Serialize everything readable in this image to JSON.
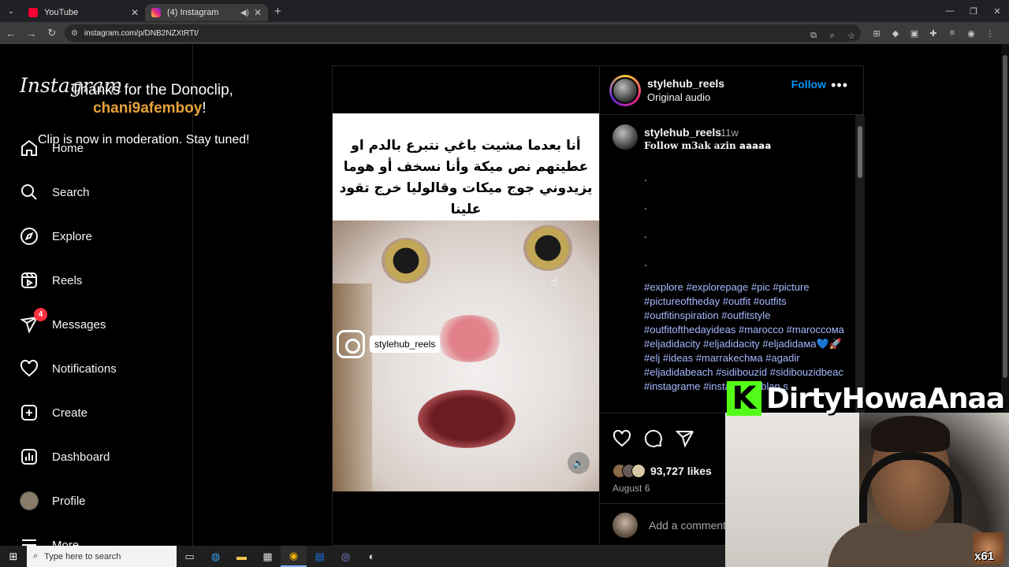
{
  "browser": {
    "tabs": [
      {
        "title": "YouTube",
        "active": false,
        "favicon": "youtube-favicon"
      },
      {
        "title": "(4) Instagram",
        "active": true,
        "favicon": "instagram-favicon"
      }
    ],
    "url": "instagram.com/p/DNB2NZXtRTt/"
  },
  "stream_alert": {
    "line1": "Thanks for the Donoclip,",
    "user": "chani9afemboy",
    "bang": "!",
    "line2": "Clip is now in moderation. Stay tuned!"
  },
  "sidebar": {
    "logo": "Instagram",
    "items": [
      {
        "label": "Home",
        "icon": "home-icon"
      },
      {
        "label": "Search",
        "icon": "search-icon"
      },
      {
        "label": "Explore",
        "icon": "compass-icon"
      },
      {
        "label": "Reels",
        "icon": "reels-icon"
      },
      {
        "label": "Messages",
        "icon": "messenger-icon",
        "badge": "4"
      },
      {
        "label": "Notifications",
        "icon": "heart-icon"
      },
      {
        "label": "Create",
        "icon": "plus-square-icon"
      },
      {
        "label": "Dashboard",
        "icon": "dashboard-icon"
      },
      {
        "label": "Profile",
        "icon": "avatar"
      },
      {
        "label": "More",
        "icon": "menu-icon"
      }
    ]
  },
  "post": {
    "media_text": "أنا بعدما مشيت باغي نتبرع بالدم او عطيتهم نص ميكة وأنا نسخف أو هوما يزيدوني جوج ميكات وقالوليا خرج تقود علينا",
    "watermark_user": "stylehub_reels",
    "header": {
      "username": "stylehub_reels",
      "audio": "Original audio",
      "follow": "Follow"
    },
    "caption": {
      "username": "stylehub_reels",
      "time": "11w",
      "line1": "Follow m3ak azin 𝗮𝗮𝗮𝗮𝗮",
      "dots": [
        ".",
        ".",
        ".",
        "."
      ],
      "hashtags": "#explore #explorepage #pic #picture #pictureoftheday #outfit #outfits #outfitinspiration #outfitstyle #outfitofthedayideas #marocco #maroccoмa #eljadidacity #eljadidacity #eljadidaмa💙🚀 #elj #ideas #marrakechмa #agadir #eljadidabeach #sidibouzid #sidibouzidbeac #instagrame #insta #casablan s"
    },
    "likes": "93,727 likes",
    "date": "August 6",
    "comment_placeholder": "Add a comment..."
  },
  "overlay": {
    "brand_letter": "K",
    "brand_name": "DirtyHowaAnaa",
    "emote_count": "x61"
  },
  "taskbar": {
    "search_placeholder": "Type here to search"
  }
}
